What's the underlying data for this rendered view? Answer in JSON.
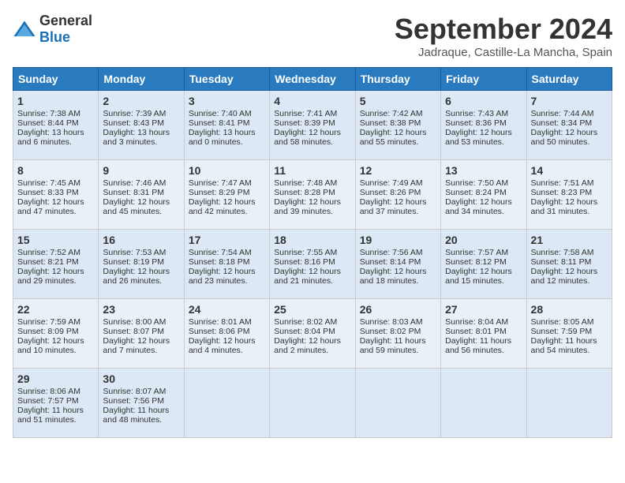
{
  "header": {
    "logo_general": "General",
    "logo_blue": "Blue",
    "month": "September 2024",
    "location": "Jadraque, Castille-La Mancha, Spain"
  },
  "days_of_week": [
    "Sunday",
    "Monday",
    "Tuesday",
    "Wednesday",
    "Thursday",
    "Friday",
    "Saturday"
  ],
  "weeks": [
    [
      {
        "day": "1",
        "sunrise": "Sunrise: 7:38 AM",
        "sunset": "Sunset: 8:44 PM",
        "daylight": "Daylight: 13 hours and 6 minutes."
      },
      {
        "day": "2",
        "sunrise": "Sunrise: 7:39 AM",
        "sunset": "Sunset: 8:43 PM",
        "daylight": "Daylight: 13 hours and 3 minutes."
      },
      {
        "day": "3",
        "sunrise": "Sunrise: 7:40 AM",
        "sunset": "Sunset: 8:41 PM",
        "daylight": "Daylight: 13 hours and 0 minutes."
      },
      {
        "day": "4",
        "sunrise": "Sunrise: 7:41 AM",
        "sunset": "Sunset: 8:39 PM",
        "daylight": "Daylight: 12 hours and 58 minutes."
      },
      {
        "day": "5",
        "sunrise": "Sunrise: 7:42 AM",
        "sunset": "Sunset: 8:38 PM",
        "daylight": "Daylight: 12 hours and 55 minutes."
      },
      {
        "day": "6",
        "sunrise": "Sunrise: 7:43 AM",
        "sunset": "Sunset: 8:36 PM",
        "daylight": "Daylight: 12 hours and 53 minutes."
      },
      {
        "day": "7",
        "sunrise": "Sunrise: 7:44 AM",
        "sunset": "Sunset: 8:34 PM",
        "daylight": "Daylight: 12 hours and 50 minutes."
      }
    ],
    [
      {
        "day": "8",
        "sunrise": "Sunrise: 7:45 AM",
        "sunset": "Sunset: 8:33 PM",
        "daylight": "Daylight: 12 hours and 47 minutes."
      },
      {
        "day": "9",
        "sunrise": "Sunrise: 7:46 AM",
        "sunset": "Sunset: 8:31 PM",
        "daylight": "Daylight: 12 hours and 45 minutes."
      },
      {
        "day": "10",
        "sunrise": "Sunrise: 7:47 AM",
        "sunset": "Sunset: 8:29 PM",
        "daylight": "Daylight: 12 hours and 42 minutes."
      },
      {
        "day": "11",
        "sunrise": "Sunrise: 7:48 AM",
        "sunset": "Sunset: 8:28 PM",
        "daylight": "Daylight: 12 hours and 39 minutes."
      },
      {
        "day": "12",
        "sunrise": "Sunrise: 7:49 AM",
        "sunset": "Sunset: 8:26 PM",
        "daylight": "Daylight: 12 hours and 37 minutes."
      },
      {
        "day": "13",
        "sunrise": "Sunrise: 7:50 AM",
        "sunset": "Sunset: 8:24 PM",
        "daylight": "Daylight: 12 hours and 34 minutes."
      },
      {
        "day": "14",
        "sunrise": "Sunrise: 7:51 AM",
        "sunset": "Sunset: 8:23 PM",
        "daylight": "Daylight: 12 hours and 31 minutes."
      }
    ],
    [
      {
        "day": "15",
        "sunrise": "Sunrise: 7:52 AM",
        "sunset": "Sunset: 8:21 PM",
        "daylight": "Daylight: 12 hours and 29 minutes."
      },
      {
        "day": "16",
        "sunrise": "Sunrise: 7:53 AM",
        "sunset": "Sunset: 8:19 PM",
        "daylight": "Daylight: 12 hours and 26 minutes."
      },
      {
        "day": "17",
        "sunrise": "Sunrise: 7:54 AM",
        "sunset": "Sunset: 8:18 PM",
        "daylight": "Daylight: 12 hours and 23 minutes."
      },
      {
        "day": "18",
        "sunrise": "Sunrise: 7:55 AM",
        "sunset": "Sunset: 8:16 PM",
        "daylight": "Daylight: 12 hours and 21 minutes."
      },
      {
        "day": "19",
        "sunrise": "Sunrise: 7:56 AM",
        "sunset": "Sunset: 8:14 PM",
        "daylight": "Daylight: 12 hours and 18 minutes."
      },
      {
        "day": "20",
        "sunrise": "Sunrise: 7:57 AM",
        "sunset": "Sunset: 8:12 PM",
        "daylight": "Daylight: 12 hours and 15 minutes."
      },
      {
        "day": "21",
        "sunrise": "Sunrise: 7:58 AM",
        "sunset": "Sunset: 8:11 PM",
        "daylight": "Daylight: 12 hours and 12 minutes."
      }
    ],
    [
      {
        "day": "22",
        "sunrise": "Sunrise: 7:59 AM",
        "sunset": "Sunset: 8:09 PM",
        "daylight": "Daylight: 12 hours and 10 minutes."
      },
      {
        "day": "23",
        "sunrise": "Sunrise: 8:00 AM",
        "sunset": "Sunset: 8:07 PM",
        "daylight": "Daylight: 12 hours and 7 minutes."
      },
      {
        "day": "24",
        "sunrise": "Sunrise: 8:01 AM",
        "sunset": "Sunset: 8:06 PM",
        "daylight": "Daylight: 12 hours and 4 minutes."
      },
      {
        "day": "25",
        "sunrise": "Sunrise: 8:02 AM",
        "sunset": "Sunset: 8:04 PM",
        "daylight": "Daylight: 12 hours and 2 minutes."
      },
      {
        "day": "26",
        "sunrise": "Sunrise: 8:03 AM",
        "sunset": "Sunset: 8:02 PM",
        "daylight": "Daylight: 11 hours and 59 minutes."
      },
      {
        "day": "27",
        "sunrise": "Sunrise: 8:04 AM",
        "sunset": "Sunset: 8:01 PM",
        "daylight": "Daylight: 11 hours and 56 minutes."
      },
      {
        "day": "28",
        "sunrise": "Sunrise: 8:05 AM",
        "sunset": "Sunset: 7:59 PM",
        "daylight": "Daylight: 11 hours and 54 minutes."
      }
    ],
    [
      {
        "day": "29",
        "sunrise": "Sunrise: 8:06 AM",
        "sunset": "Sunset: 7:57 PM",
        "daylight": "Daylight: 11 hours and 51 minutes."
      },
      {
        "day": "30",
        "sunrise": "Sunrise: 8:07 AM",
        "sunset": "Sunset: 7:56 PM",
        "daylight": "Daylight: 11 hours and 48 minutes."
      },
      {
        "day": "",
        "sunrise": "",
        "sunset": "",
        "daylight": ""
      },
      {
        "day": "",
        "sunrise": "",
        "sunset": "",
        "daylight": ""
      },
      {
        "day": "",
        "sunrise": "",
        "sunset": "",
        "daylight": ""
      },
      {
        "day": "",
        "sunrise": "",
        "sunset": "",
        "daylight": ""
      },
      {
        "day": "",
        "sunrise": "",
        "sunset": "",
        "daylight": ""
      }
    ]
  ]
}
